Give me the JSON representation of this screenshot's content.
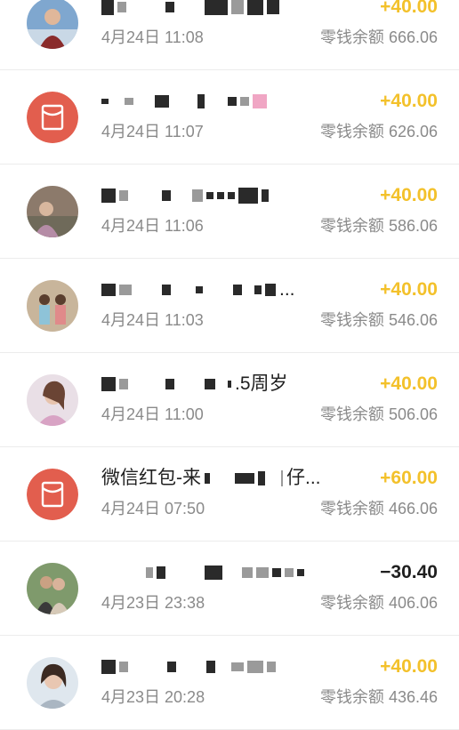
{
  "transactions": [
    {
      "avatar": "photo-avatar",
      "title_visible": "",
      "time": "4月24日 11:08",
      "amount": "+40.00",
      "balance": "零钱余额 666.06"
    },
    {
      "avatar": "red-envelope-icon",
      "title_visible": "",
      "time": "4月24日 11:07",
      "amount": "+40.00",
      "balance": "零钱余额 626.06"
    },
    {
      "avatar": "photo-avatar",
      "title_visible": "",
      "time": "4月24日 11:06",
      "amount": "+40.00",
      "balance": "零钱余额 586.06"
    },
    {
      "avatar": "photo-avatar",
      "title_visible": "...",
      "time": "4月24日 11:03",
      "amount": "+40.00",
      "balance": "零钱余额 546.06"
    },
    {
      "avatar": "photo-avatar",
      "title_visible": ".5周岁",
      "time": "4月24日 11:00",
      "amount": "+40.00",
      "balance": "零钱余额 506.06"
    },
    {
      "avatar": "red-envelope-icon",
      "title_visible": "微信红包-来",
      "title_suffix": "仔...",
      "time": "4月24日 07:50",
      "amount": "+60.00",
      "balance": "零钱余额 466.06"
    },
    {
      "avatar": "photo-avatar",
      "title_visible": "",
      "time": "4月23日 23:38",
      "amount": "−30.40",
      "balance": "零钱余额 406.06"
    },
    {
      "avatar": "photo-avatar",
      "title_visible": "",
      "time": "4月23日 20:28",
      "amount": "+40.00",
      "balance": "零钱余额 436.46"
    }
  ],
  "colors": {
    "income": "#f3c12b",
    "expense": "#1f1f1f",
    "envelope": "#e25e4e"
  }
}
